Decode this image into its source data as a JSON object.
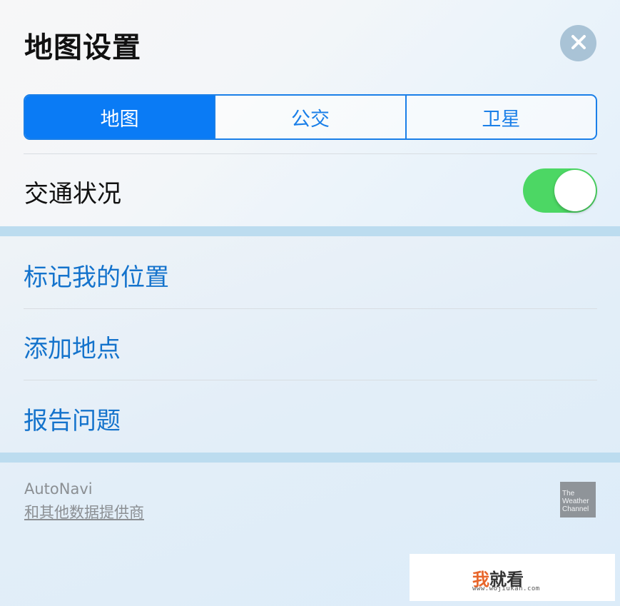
{
  "header": {
    "title": "地图设置",
    "close_icon": "close-icon"
  },
  "map_type": {
    "options": [
      "地图",
      "公交",
      "卫星"
    ],
    "selected": "地图"
  },
  "traffic": {
    "label": "交通状况",
    "enabled": true
  },
  "actions": [
    {
      "label": "标记我的位置"
    },
    {
      "label": "添加地点"
    },
    {
      "label": "报告问题"
    }
  ],
  "credits": {
    "provider": "AutoNavi",
    "others_link": "和其他数据提供商",
    "weather_logo": "The Weather Channel"
  },
  "watermark": {
    "logo_first": "我",
    "logo_rest": "就看",
    "url": "www.wojiukan.com"
  },
  "colors": {
    "accent": "#0a7bf5",
    "link": "#1473cc",
    "toggle_on": "#4cd764",
    "band": "#bcdcef"
  }
}
